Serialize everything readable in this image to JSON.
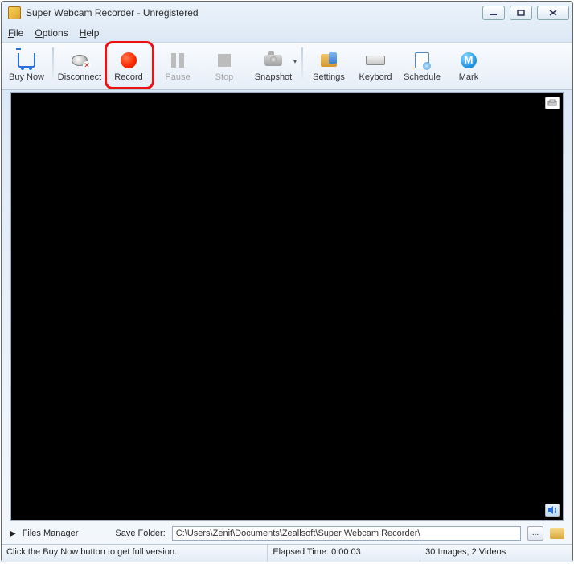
{
  "window": {
    "title": "Super Webcam Recorder - Unregistered"
  },
  "menu": {
    "file": "File",
    "options": "Options",
    "help": "Help"
  },
  "toolbar": {
    "buynow": "Buy Now",
    "disconnect": "Disconnect",
    "record": "Record",
    "pause": "Pause",
    "stop": "Stop",
    "snapshot": "Snapshot",
    "settings": "Settings",
    "keyboard": "Keybord",
    "schedule": "Schedule",
    "mark": "Mark",
    "mark_letter": "M"
  },
  "filesbar": {
    "files_manager": "Files Manager",
    "save_folder_label": "Save Folder:",
    "save_folder_path": "C:\\Users\\Zenit\\Documents\\Zeallsoft\\Super Webcam Recorder\\",
    "browse": "..."
  },
  "status": {
    "hint": "Click the Buy Now button to get full version.",
    "elapsed": "Elapsed Time: 0:00:03",
    "counts": "30 Images, 2 Videos"
  }
}
